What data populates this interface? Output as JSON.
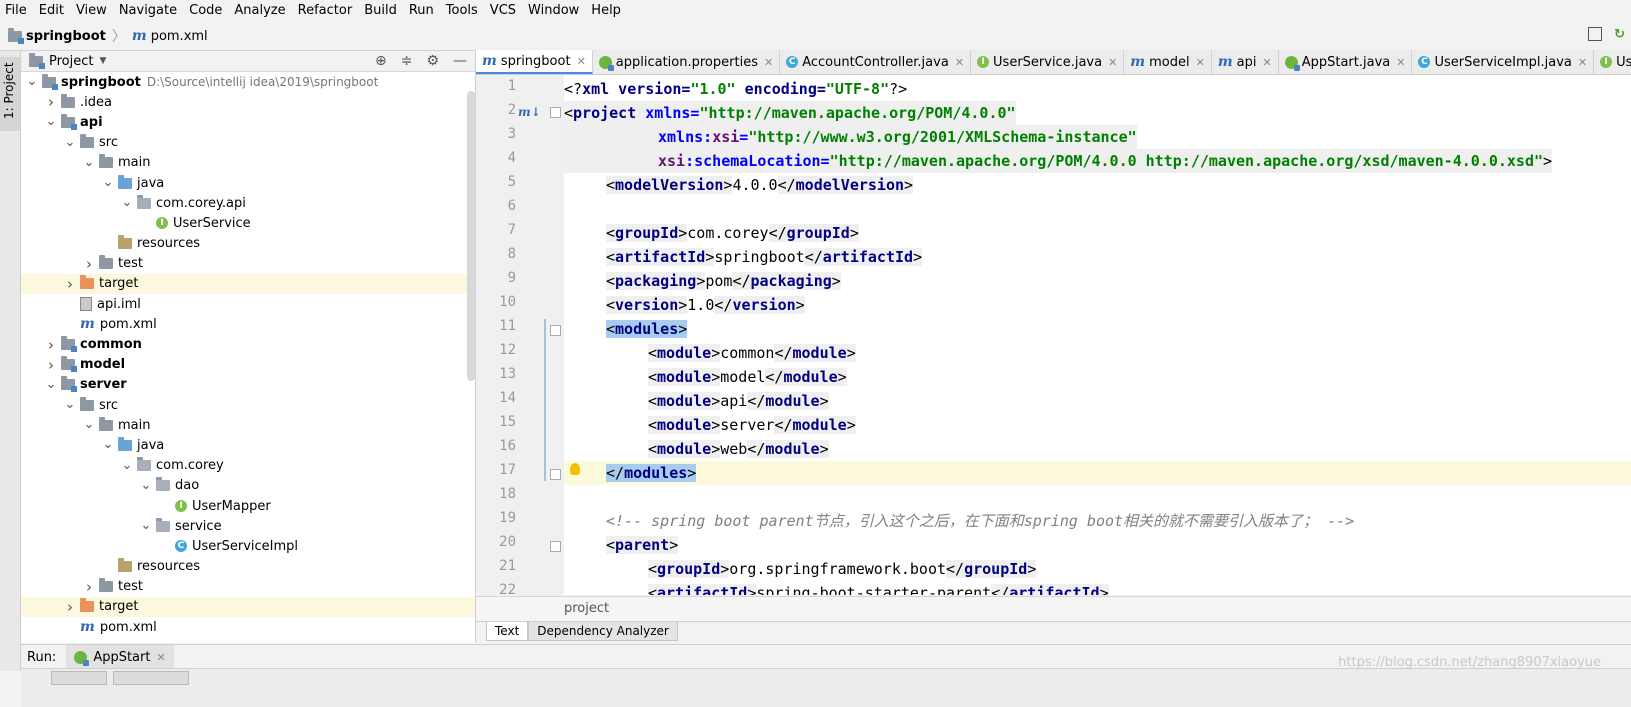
{
  "menu": [
    "File",
    "Edit",
    "View",
    "Navigate",
    "Code",
    "Analyze",
    "Refactor",
    "Build",
    "Run",
    "Tools",
    "VCS",
    "Window",
    "Help"
  ],
  "nav": {
    "project": "springboot",
    "file": "pom.xml"
  },
  "leftstrip": {
    "label": "1: Project"
  },
  "project_panel": {
    "title": "Project",
    "tree": [
      {
        "depth": 0,
        "open": true,
        "icon": "module-folder",
        "label": "springboot",
        "bold": true,
        "path": "D:\\Source\\intellij idea\\2019\\springboot"
      },
      {
        "depth": 1,
        "open": false,
        "icon": "folder",
        "label": ".idea"
      },
      {
        "depth": 1,
        "open": true,
        "icon": "module-folder",
        "label": "api",
        "bold": true
      },
      {
        "depth": 2,
        "open": true,
        "icon": "folder",
        "label": "src"
      },
      {
        "depth": 3,
        "open": true,
        "icon": "folder",
        "label": "main"
      },
      {
        "depth": 4,
        "open": true,
        "icon": "folder-blue",
        "label": "java"
      },
      {
        "depth": 5,
        "open": true,
        "icon": "package",
        "label": "com.corey.api"
      },
      {
        "depth": 6,
        "leaf": true,
        "icon": "interface",
        "label": "UserService"
      },
      {
        "depth": 4,
        "leaf": true,
        "icon": "folder-res",
        "label": "resources"
      },
      {
        "depth": 3,
        "open": false,
        "icon": "folder",
        "label": "test"
      },
      {
        "depth": 2,
        "open": false,
        "icon": "folder-orange",
        "label": "target",
        "hl": true
      },
      {
        "depth": 2,
        "leaf": true,
        "icon": "iml",
        "label": "api.iml"
      },
      {
        "depth": 2,
        "leaf": true,
        "icon": "maven",
        "label": "pom.xml"
      },
      {
        "depth": 1,
        "open": false,
        "icon": "module-folder",
        "label": "common",
        "bold": true
      },
      {
        "depth": 1,
        "open": false,
        "icon": "module-folder",
        "label": "model",
        "bold": true
      },
      {
        "depth": 1,
        "open": true,
        "icon": "module-folder",
        "label": "server",
        "bold": true
      },
      {
        "depth": 2,
        "open": true,
        "icon": "folder",
        "label": "src"
      },
      {
        "depth": 3,
        "open": true,
        "icon": "folder",
        "label": "main"
      },
      {
        "depth": 4,
        "open": true,
        "icon": "folder-blue",
        "label": "java"
      },
      {
        "depth": 5,
        "open": true,
        "icon": "package",
        "label": "com.corey"
      },
      {
        "depth": 6,
        "open": true,
        "icon": "package",
        "label": "dao"
      },
      {
        "depth": 7,
        "leaf": true,
        "icon": "interface",
        "label": "UserMapper"
      },
      {
        "depth": 6,
        "open": true,
        "icon": "package",
        "label": "service"
      },
      {
        "depth": 7,
        "leaf": true,
        "icon": "class",
        "label": "UserServiceImpl"
      },
      {
        "depth": 4,
        "leaf": true,
        "icon": "folder-res",
        "label": "resources"
      },
      {
        "depth": 3,
        "open": false,
        "icon": "folder",
        "label": "test"
      },
      {
        "depth": 2,
        "open": false,
        "icon": "folder-orange",
        "label": "target",
        "hl": true
      },
      {
        "depth": 2,
        "leaf": true,
        "icon": "maven",
        "label": "pom.xml"
      }
    ]
  },
  "tabs": [
    {
      "icon": "maven",
      "label": "springboot",
      "active": true
    },
    {
      "icon": "spring",
      "label": "application.properties"
    },
    {
      "icon": "class",
      "label": "AccountController.java"
    },
    {
      "icon": "interface",
      "label": "UserService.java"
    },
    {
      "icon": "maven",
      "label": "model"
    },
    {
      "icon": "maven",
      "label": "api"
    },
    {
      "icon": "spring",
      "label": "AppStart.java"
    },
    {
      "icon": "class",
      "label": "UserServiceImpl.java"
    },
    {
      "icon": "interface",
      "label": "UserMapp"
    }
  ],
  "code_lines": [
    {
      "n": "1"
    },
    {
      "n": "2"
    },
    {
      "n": "3"
    },
    {
      "n": "4"
    },
    {
      "n": "5"
    },
    {
      "n": "6"
    },
    {
      "n": "7"
    },
    {
      "n": "8"
    },
    {
      "n": "9"
    },
    {
      "n": "10"
    },
    {
      "n": "11"
    },
    {
      "n": "12"
    },
    {
      "n": "13"
    },
    {
      "n": "14"
    },
    {
      "n": "15"
    },
    {
      "n": "16"
    },
    {
      "n": "17"
    },
    {
      "n": "18"
    },
    {
      "n": "19"
    },
    {
      "n": "20"
    },
    {
      "n": "21"
    },
    {
      "n": "22"
    }
  ],
  "code": {
    "l1": {
      "a": "<?",
      "b": "xml version=",
      "c": "\"1.0\"",
      "d": " encoding=",
      "e": "\"UTF-8\"",
      "f": "?>"
    },
    "l2": {
      "a": "<",
      "b": "project ",
      "c": "xmlns=",
      "d": "\"http://maven.apache.org/POM/4.0.0\""
    },
    "l3": {
      "a": "xmlns:",
      "b": "xsi",
      "c": "=",
      "d": "\"http://www.w3.org/2001/XMLSchema-instance\""
    },
    "l4": {
      "a": "xsi",
      "b": ":schemaLocation=",
      "c": "\"http://maven.apache.org/POM/4.0.0 http://maven.apache.org/xsd/maven-4.0.0.xsd\"",
      "d": ">"
    },
    "l5": {
      "t": "modelVersion",
      "v": "4.0.0"
    },
    "l7": {
      "t": "groupId",
      "v": "com.corey"
    },
    "l8": {
      "t": "artifactId",
      "v": "springboot"
    },
    "l9": {
      "t": "packaging",
      "v": "pom"
    },
    "l10": {
      "t": "version",
      "v": "1.0"
    },
    "l11": {
      "t": "modules"
    },
    "l12": {
      "t": "module",
      "v": "common"
    },
    "l13": {
      "t": "module",
      "v": "model"
    },
    "l14": {
      "t": "module",
      "v": "api"
    },
    "l15": {
      "t": "module",
      "v": "server"
    },
    "l16": {
      "t": "module",
      "v": "web"
    },
    "l17": {
      "t": "modules"
    },
    "l19": {
      "c": "<!-- spring boot parent节点，引入这个之后，在下面和spring boot相关的就不需要引入版本了； -->"
    },
    "l20": {
      "t": "parent"
    },
    "l21": {
      "t": "groupId",
      "v": "org.springframework.boot"
    },
    "l22": {
      "t": "artifactId",
      "v": "spring-boot-starter-parent"
    }
  },
  "xmlpath": "project",
  "bottom_tabs": [
    "Text",
    "Dependency Analyzer"
  ],
  "run": {
    "label": "Run:",
    "tab": "AppStart"
  },
  "watermark": "https://blog.csdn.net/zhang8907xiaoyue"
}
